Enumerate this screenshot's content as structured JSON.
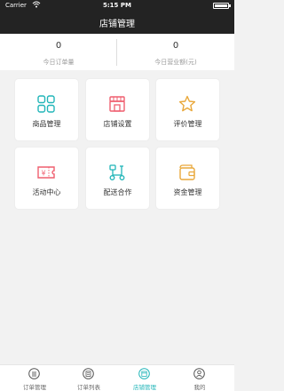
{
  "status_bar": {
    "carrier": "Carrier",
    "time": "5:15 PM"
  },
  "header": {
    "title": "店铺管理"
  },
  "stats": [
    {
      "value": "0",
      "label": "今日订单量"
    },
    {
      "value": "0",
      "label": "今日营业额(元)"
    }
  ],
  "menu": [
    {
      "label": "商品管理",
      "icon": "grid-icon",
      "color": "#21b5b8"
    },
    {
      "label": "店铺设置",
      "icon": "store-icon",
      "color": "#ef5f6f"
    },
    {
      "label": "评价管理",
      "icon": "star-icon",
      "color": "#e9a83b"
    },
    {
      "label": "活动中心",
      "icon": "coupon-icon",
      "color": "#ef5f6f"
    },
    {
      "label": "配送合作",
      "icon": "scooter-icon",
      "color": "#21b5b8"
    },
    {
      "label": "资金管理",
      "icon": "wallet-icon",
      "color": "#e9a83b"
    }
  ],
  "tabs": [
    {
      "label": "订单管理",
      "icon": "menu-circle-icon"
    },
    {
      "label": "订单列表",
      "icon": "list-circle-icon"
    },
    {
      "label": "店铺管理",
      "icon": "store-circle-icon",
      "active": true
    },
    {
      "label": "我的",
      "icon": "user-circle-icon"
    }
  ],
  "colors": {
    "header_bg": "#232323",
    "accent": "#21b5b8",
    "background": "#f2f2f2"
  }
}
